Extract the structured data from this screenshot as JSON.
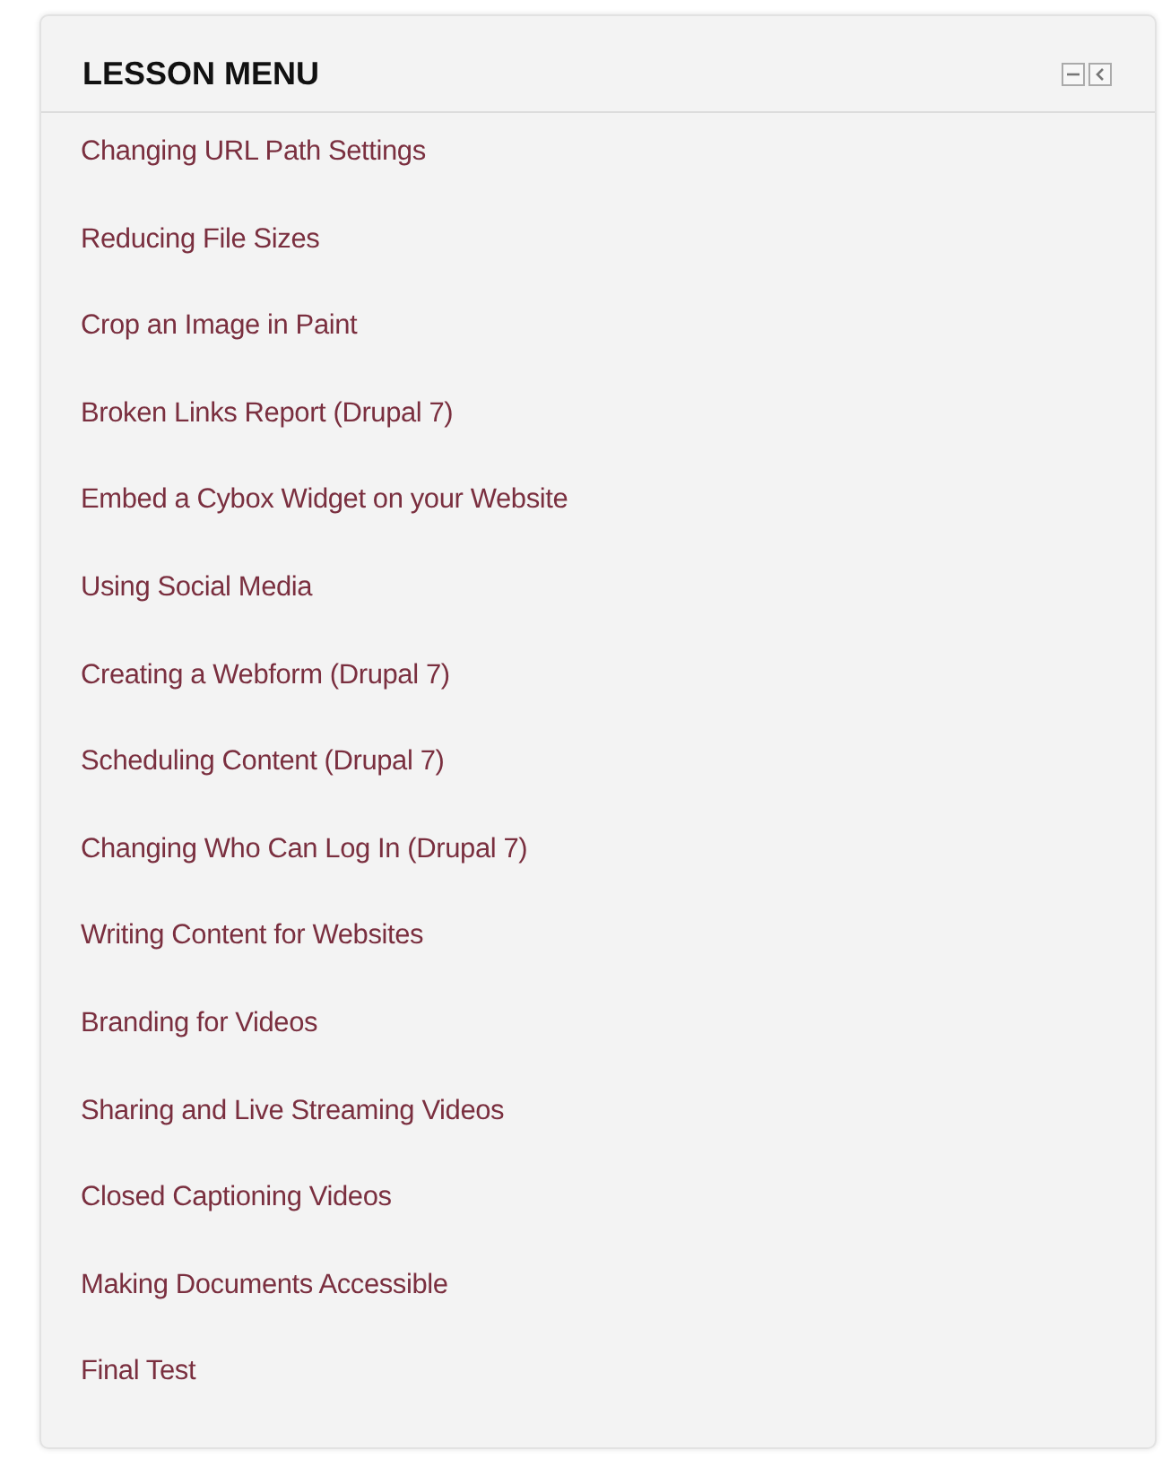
{
  "block": {
    "title": "LESSON MENU",
    "items": [
      "Changing URL Path Settings",
      "Reducing File Sizes",
      "Crop an Image in Paint",
      "Broken Links Report (Drupal 7)",
      "Embed a Cybox Widget on your Website",
      "Using Social Media",
      "Creating a Webform (Drupal 7)",
      "Scheduling Content (Drupal 7)",
      "Changing Who Can Log In (Drupal 7)",
      "Writing Content for Websites",
      "Branding for Videos",
      "Sharing and Live Streaming Videos",
      "Closed Captioning Videos",
      "Making Documents Accessible",
      "Final Test"
    ]
  }
}
